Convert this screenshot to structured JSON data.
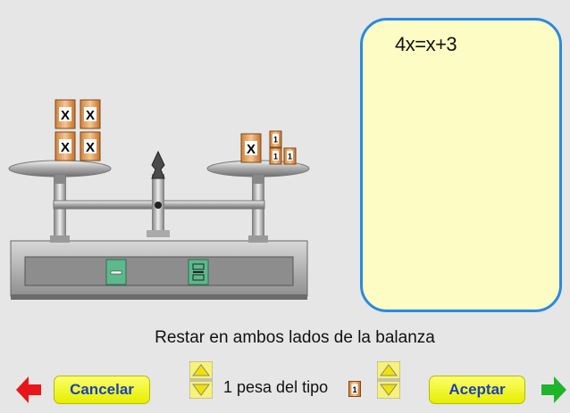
{
  "equation": "4x=x+3",
  "instruction": "Restar en ambos lados de la balanza",
  "controls": {
    "cancel_label": "Cancelar",
    "accept_label": "Aceptar",
    "weights_label": "1 pesa del tipo",
    "selected_weight_type": "1"
  },
  "balance": {
    "left_pan_x_weights": 4,
    "right_pan_x_weights": 1,
    "right_pan_unit_weights": 3,
    "weight_x_label": "X",
    "weight_unit_label": "1",
    "operations": [
      "minus",
      "divide"
    ]
  },
  "colors": {
    "panel_background": "#fdfcc4",
    "panel_border": "#2a8ae0",
    "button": "#f0f500",
    "button_text": "#1c3fbf",
    "back_arrow": "#e8161a",
    "next_arrow": "#1fb52a",
    "op_button": "#5db88c"
  }
}
